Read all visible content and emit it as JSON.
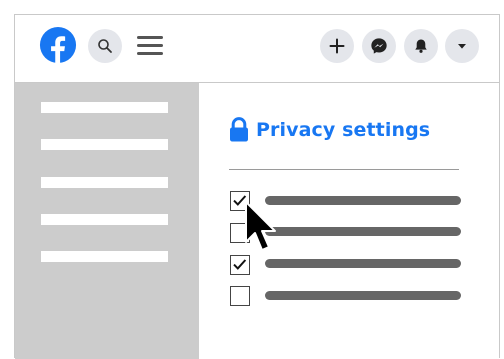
{
  "header": {
    "logo": {
      "icon": "facebook-logo-icon",
      "brand_color": "#1877f2"
    },
    "search": {
      "icon": "search-icon"
    },
    "menu": {
      "icon": "hamburger-menu-icon"
    },
    "actions": [
      {
        "icon": "plus-icon"
      },
      {
        "icon": "messenger-icon"
      },
      {
        "icon": "bell-icon"
      },
      {
        "icon": "caret-down-icon"
      }
    ]
  },
  "sidebar": {
    "items": [
      "",
      "",
      "",
      "",
      ""
    ]
  },
  "main": {
    "title": "Privacy settings",
    "title_icon": "lock-icon",
    "title_color": "#1877f2",
    "options": [
      {
        "checked": true,
        "label": ""
      },
      {
        "checked": false,
        "label": ""
      },
      {
        "checked": true,
        "label": ""
      },
      {
        "checked": false,
        "label": ""
      }
    ]
  },
  "cursor": {
    "icon": "mouse-pointer-icon"
  }
}
